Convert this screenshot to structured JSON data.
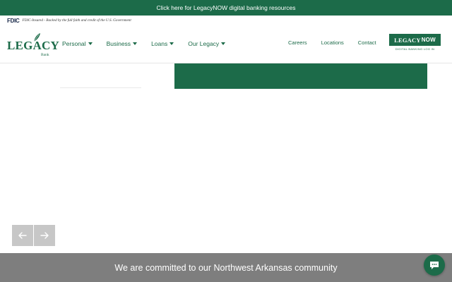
{
  "banner": {
    "text": "Click here for LegacyNOW digital banking resources"
  },
  "fdic": {
    "logo": "FDIC",
    "text": "FDIC-Insured - Backed by the full faith and credit of the U.S. Government"
  },
  "brand": {
    "name": "LEGACY",
    "sub": "Bank",
    "color": "#1c6b49"
  },
  "nav": {
    "main": [
      {
        "label": "Personal"
      },
      {
        "label": "Business"
      },
      {
        "label": "Loans"
      },
      {
        "label": "Our Legacy"
      }
    ],
    "utility": [
      {
        "label": "Careers"
      },
      {
        "label": "Locations"
      },
      {
        "label": "Contact"
      }
    ]
  },
  "legacy_now": {
    "word": "LEGACY",
    "now": "NOW",
    "sub": "DIGITAL BANKING LOG IN"
  },
  "footer": {
    "text": "We are committed to our Northwest Arkansas community"
  },
  "icons": {
    "prev": "arrow-left-icon",
    "next": "arrow-right-icon",
    "chat": "chat-bubble-icon",
    "leaf": "leaf-icon"
  }
}
